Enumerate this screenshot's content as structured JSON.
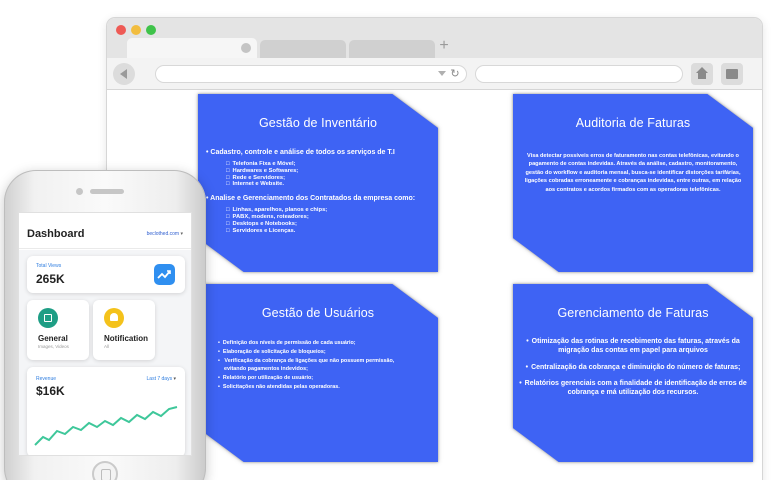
{
  "cards": {
    "inventario": {
      "title": "Gestão de Inventário",
      "bullet1": "• Cadastro, controle e análise de todos os serviços de T.I",
      "sub1": [
        "Telefonia Fixa e Móvel;",
        "Hardwares e Softwares;",
        "Rede e Servidores;",
        "Internet e Website."
      ],
      "bullet2": "• Analise e Gerenciamento dos Contratados da empresa como:",
      "sub2": [
        "Linhas, aparelhos, planos e chips;",
        "PABX, modens, roteadores;",
        "Desktops e Notebooks;",
        "Servidores e Licenças."
      ]
    },
    "auditoria": {
      "title": "Auditoria de Faturas",
      "text": "Visa detectar possíveis erros de faturamento nas contas telefônicas, evitando o pagamento de contas indevidas. Através da análise, cadastro, monitoramento, gestão do workflow e auditoria mensal, busca-se identificar distorções tarifárias, ligações cobradas erroneamente e cobranças indevidas, entre outras, em relação aos contratos e acordos firmados com as operadoras telefônicas."
    },
    "usuarios": {
      "title": "Gestão de Usuários",
      "items": [
        "Definição dos níveis de permissão de cada usuário;",
        "Elaboração de solicitação de bloqueios;",
        "Verificação da cobrança de ligações que não possuem permissão,",
        "Relatório por utilização de usuário;",
        "Solicitações não atendidas pelas operadoras."
      ],
      "item3_cont": "evitando pagamentos indevidos;"
    },
    "faturas": {
      "title": "Gerenciamento de Faturas",
      "items": [
        "Otimização das rotinas de recebimento das faturas, através da migração das contas em papel para arquivos",
        "Centralização da cobrança e diminuição do número de faturas;",
        "Relatórios gerenciais com a finalidade de identificação de erros de cobrança e má utilização dos recursos."
      ]
    }
  },
  "phone": {
    "header": {
      "title": "Dashboard",
      "user": "beclothed.com"
    },
    "views": {
      "label": "Total Views",
      "value": "265K"
    },
    "general": {
      "title": "General",
      "sub": "Images, Videos"
    },
    "notification": {
      "title": "Notification",
      "sub": "All"
    },
    "revenue": {
      "label": "Revenue",
      "value": "$16K",
      "range": "Last 7 days"
    }
  },
  "colors": {
    "card_blue": "#3e63f4",
    "accent_blue": "#2f8ff0",
    "general_green": "#1e9e85",
    "notif_yellow": "#f4c21b",
    "chart_green": "#3ec79a"
  },
  "icons": {
    "views": "trending-up-icon",
    "general": "image-icon",
    "notification": "bell-icon"
  }
}
